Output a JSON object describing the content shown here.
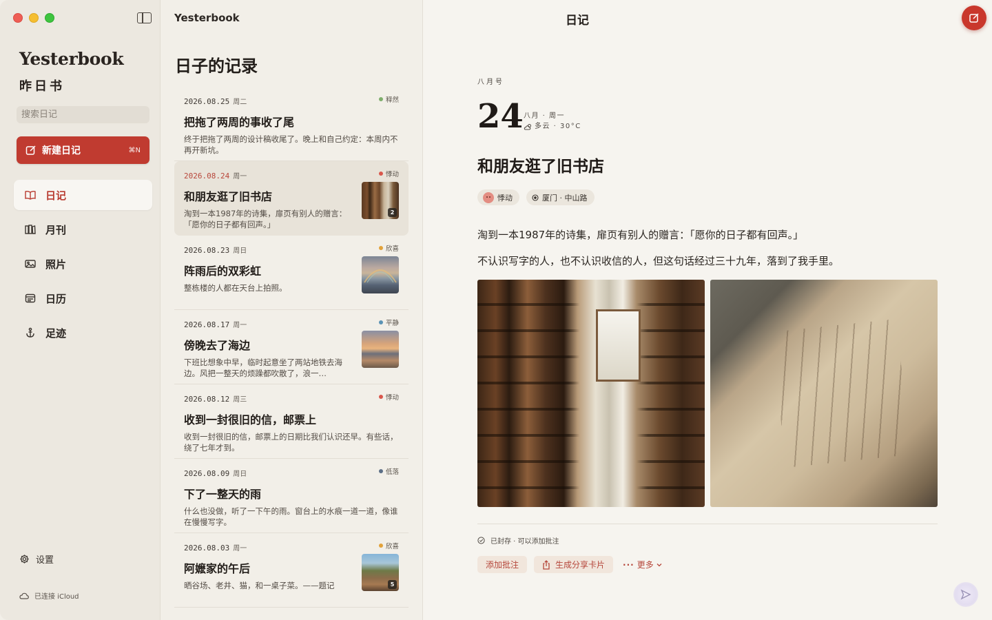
{
  "app": {
    "name": "Yesterbook",
    "subtitle": "昨日书"
  },
  "sidebar": {
    "search_placeholder": "搜索日记",
    "new_entry": {
      "label": "新建日记",
      "shortcut": "⌘N"
    },
    "nav": [
      {
        "label": "日记",
        "icon": "book-icon",
        "active": true
      },
      {
        "label": "月刊",
        "icon": "magazine-icon",
        "active": false
      },
      {
        "label": "照片",
        "icon": "photo-icon",
        "active": false
      },
      {
        "label": "日历",
        "icon": "calendar-icon",
        "active": false
      },
      {
        "label": "足迹",
        "icon": "anchor-icon",
        "active": false
      }
    ],
    "settings_label": "设置",
    "icloud_status": "已连接 iCloud"
  },
  "list": {
    "window_title": "Yesterbook",
    "heading": "日子的记录",
    "entries": [
      {
        "date": "2026.08.25",
        "weekday": "周二",
        "mood": "释然",
        "mood_color": "#7fae6c",
        "title": "把拖了两周的事收了尾",
        "excerpt": "终于把拖了两周的设计稿收尾了。晚上和自己约定：本周内不再开新坑。",
        "thumb": null,
        "count": null,
        "selected": false
      },
      {
        "date": "2026.08.24",
        "weekday": "周一",
        "mood": "悸动",
        "mood_color": "#d9574c",
        "title": "和朋友逛了旧书店",
        "excerpt": "淘到一本1987年的诗集，扉页有别人的赠言：「愿你的日子都有回声。」",
        "thumb": "books",
        "count": "2",
        "selected": true
      },
      {
        "date": "2026.08.23",
        "weekday": "周日",
        "mood": "欣喜",
        "mood_color": "#e2a23a",
        "title": "阵雨后的双彩虹",
        "excerpt": "整栋楼的人都在天台上拍照。",
        "thumb": "rainbow",
        "count": null,
        "selected": false
      },
      {
        "date": "2026.08.17",
        "weekday": "周一",
        "mood": "平静",
        "mood_color": "#5b93b5",
        "title": "傍晚去了海边",
        "excerpt": "下班比想象中早，临时起意坐了两站地铁去海边。风把一整天的烦躁都吹散了，浪一…",
        "thumb": "sea",
        "count": null,
        "selected": false
      },
      {
        "date": "2026.08.12",
        "weekday": "周三",
        "mood": "悸动",
        "mood_color": "#d9574c",
        "title": "收到一封很旧的信，邮票上",
        "excerpt": "收到一封很旧的信，邮票上的日期比我们认识还早。有些话，绕了七年才到。",
        "thumb": null,
        "count": null,
        "selected": false
      },
      {
        "date": "2026.08.09",
        "weekday": "周日",
        "mood": "低落",
        "mood_color": "#5c6f86",
        "title": "下了一整天的雨",
        "excerpt": "什么也没做，听了一下午的雨。窗台上的水痕一道一道，像谁在慢慢写字。",
        "thumb": null,
        "count": null,
        "selected": false
      },
      {
        "date": "2026.08.03",
        "weekday": "周一",
        "mood": "欣喜",
        "mood_color": "#e2a23a",
        "title": "阿嬷家的午后",
        "excerpt": "晒谷场、老井、猫，和一桌子菜。——题记",
        "thumb": "village",
        "count": "5",
        "selected": false
      }
    ]
  },
  "detail": {
    "window_title": "日记",
    "month_label": "八月号",
    "day": "24",
    "month_weekday": "八月 · 周一",
    "weather": "多云 · 30°C",
    "title": "和朋友逛了旧书店",
    "tags": {
      "mood": "悸动",
      "location": "厦门 · 中山路"
    },
    "paragraphs": [
      "淘到一本1987年的诗集，扉页有别人的赠言：「愿你的日子都有回声。」",
      "不认识写字的人，也不认识收信的人，但这句话经过三十九年，落到了我手里。"
    ],
    "sealed_status": "已封存 · 可以添加批注",
    "actions": {
      "annotate": "添加批注",
      "share_card": "生成分享卡片",
      "more": "更多"
    }
  },
  "colors": {
    "accent": "#c03b30",
    "sidebar_bg": "#ece8e0",
    "list_bg": "#f2efe8",
    "detail_bg": "#f6f4ef"
  }
}
